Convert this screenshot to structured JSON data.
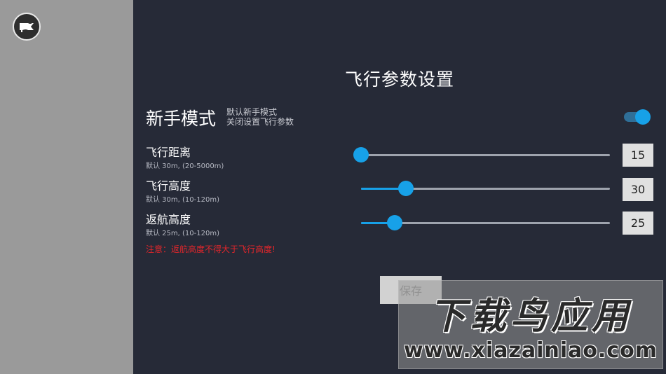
{
  "back": {
    "icon": "flag-icon"
  },
  "title": "飞行参数设置",
  "novice": {
    "label": "新手模式",
    "desc_line1": "默认新手模式",
    "desc_line2": "关闭设置飞行参数",
    "enabled": true
  },
  "params": [
    {
      "label": "飞行距离",
      "hint": "默认 30m, (20-5000m)",
      "value": "15",
      "fraction": 0.0
    },
    {
      "label": "飞行高度",
      "hint": "默认 30m, (10-120m)",
      "value": "30",
      "fraction": 0.18
    },
    {
      "label": "返航高度",
      "hint": "默认 25m, (10-120m)",
      "value": "25",
      "fraction": 0.135
    }
  ],
  "warning": "注意：返航高度不得大于飞行高度!",
  "save_label": "保存",
  "watermark": {
    "title": "下载鸟应用",
    "url": "www.xiazainiao.com"
  },
  "colors": {
    "accent": "#17a1e8",
    "warning": "#e0262b",
    "background": "#262a37"
  }
}
